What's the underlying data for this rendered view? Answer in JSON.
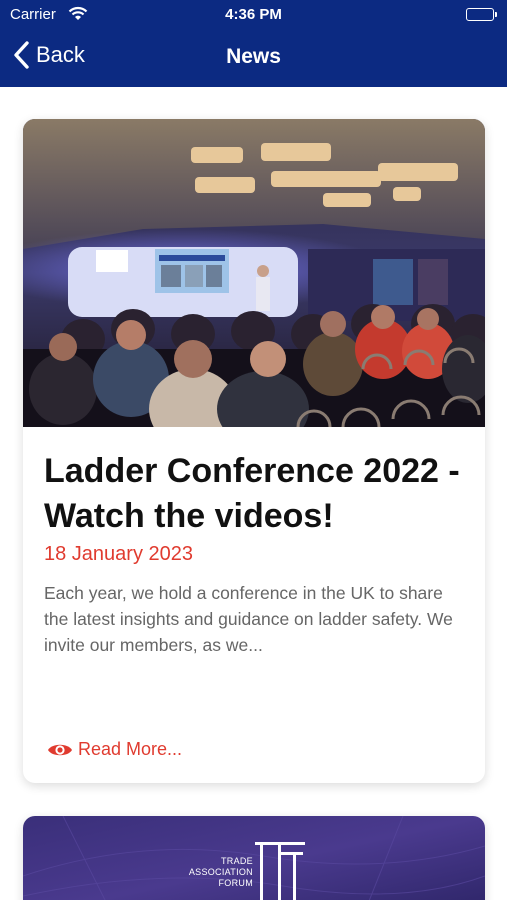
{
  "status_bar": {
    "carrier": "Carrier",
    "time": "4:36 PM"
  },
  "nav": {
    "back_label": "Back",
    "title": "News"
  },
  "articles": [
    {
      "title": "Ladder Conference 2022 - Watch the videos!",
      "date": "18 January 2023",
      "excerpt": "Each year, we hold a conference in the UK to share the latest insights and guidance on ladder safety. We invite our members, as we...",
      "read_more": "Read More..."
    },
    {
      "logo_line1": "TRADE",
      "logo_line2": "ASSOCIATION",
      "logo_line3": "FORUM"
    }
  ],
  "colors": {
    "header": "#0c2a82",
    "accent": "#e03b2f"
  }
}
